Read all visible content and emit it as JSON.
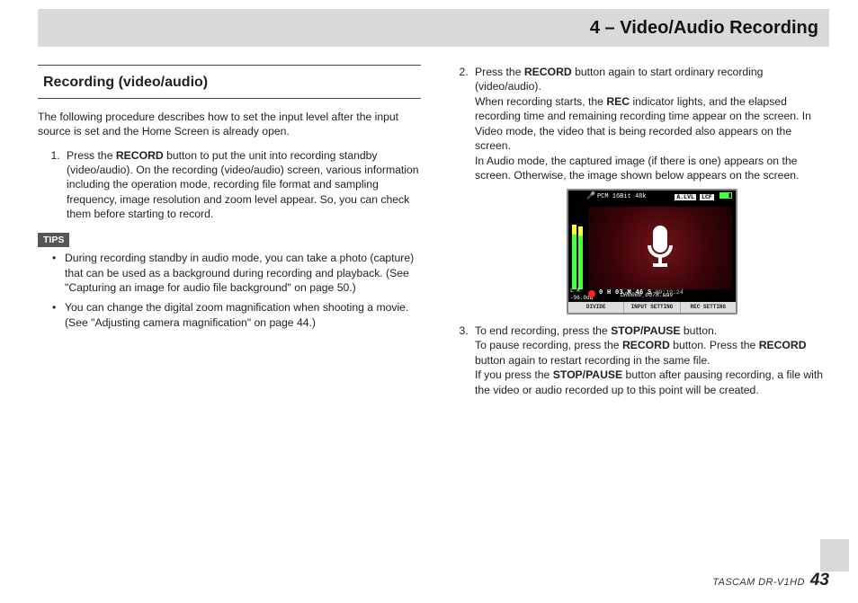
{
  "chapter": "4 – Video/Audio Recording",
  "section_heading": "Recording (video/audio)",
  "intro": "The following procedure describes how to set the input level after the input source is set and the Home Screen is already open.",
  "step1": {
    "a": "Press the ",
    "b": "RECORD",
    "c": " button to put the unit into recording standby (video/audio). On the recording (video/audio) screen, various information including the operation mode, recording file format and sampling frequency, image resolution and zoom level appear. So, you can check them before starting to record."
  },
  "tips_label": "TIPS",
  "tip1": "During recording standby in audio mode, you can take a photo (capture) that can be used as a background during recording and playback. (See \"Capturing an image for audio file background\" on page 50.)",
  "tip2": "You can change the digital zoom magnification when shooting a movie. (See \"Adjusting camera magnification\" on page 44.)",
  "step2": {
    "a": "Press the ",
    "b": "RECORD",
    "c": " button again to start ordinary recording (video/audio).",
    "d": "When recording starts, the ",
    "e": "REC",
    "f": " indicator lights, and the elapsed recording time and remaining recording time appear on the screen. In Video mode, the video that is being recorded also appears on the screen.",
    "g": "In Audio mode, the captured image (if there is one) appears on the screen. Otherwise, the image shown below appears on the screen."
  },
  "step3": {
    "a": "To end recording, press the ",
    "b": "STOP/PAUSE",
    "c": " button.",
    "d": "To pause recording, press the ",
    "e": "RECORD",
    "f": " button. Press the ",
    "g": "RECORD",
    "h": " button again to restart recording in the same file.",
    "i": "If you press the ",
    "j": "STOP/PAUSE",
    "k": " button after pausing recording, a file with the video or audio recorded up to this point will be created."
  },
  "device": {
    "format": "PCM 16Bit 48k",
    "badge1": "A.LVL",
    "badge2": "LCF",
    "db": "-96.0dB",
    "lr": "L R",
    "timecode": "0 H 03 M 46 S",
    "remaining": "00:19:24",
    "filename": "DR0000_0078.wav",
    "btn1": "DIVIDE",
    "btn2": "INPUT SETTING",
    "btn3": "REC SETTING"
  },
  "footer": {
    "model": "TASCAM  DR-V1HD",
    "page": "43"
  }
}
